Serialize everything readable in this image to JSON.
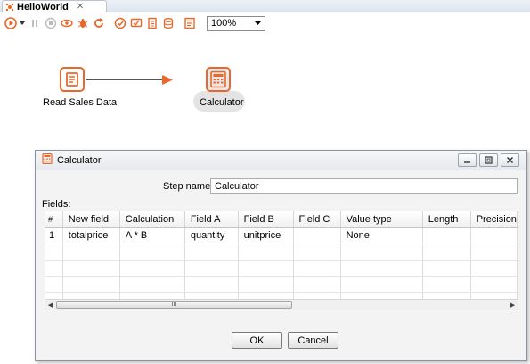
{
  "tab": {
    "title": "HelloWorld",
    "close": "✕"
  },
  "toolbar": {
    "zoom": "100%"
  },
  "canvas": {
    "steps": [
      {
        "label": "Read Sales Data",
        "icon": "table-input-icon"
      },
      {
        "label": "Calculator",
        "icon": "calculator-icon"
      }
    ]
  },
  "dialog": {
    "title": "Calculator",
    "step_name_label": "Step name",
    "step_name_value": "Calculator",
    "fields_label": "Fields:",
    "columns": [
      "#",
      "New field",
      "Calculation",
      "Field A",
      "Field B",
      "Field C",
      "Value type",
      "Length",
      "Precision"
    ],
    "rows": [
      [
        "1",
        "totalprice",
        "A * B",
        "quantity",
        "unitprice",
        "",
        "None",
        "",
        ""
      ]
    ],
    "scroll_thumb": "III",
    "ok_label": "OK",
    "cancel_label": "Cancel"
  },
  "colors": {
    "accent": "#e9672a"
  }
}
